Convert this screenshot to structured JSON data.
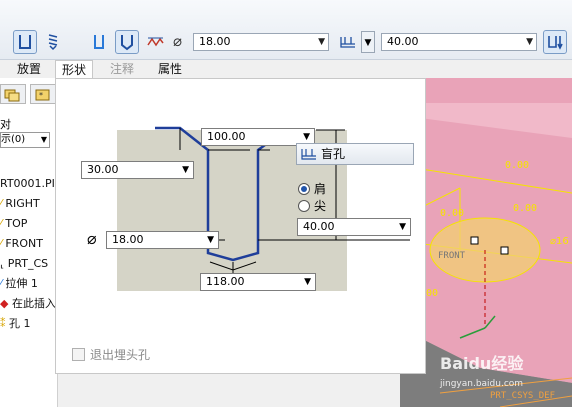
{
  "toolbar": {
    "diameter_symbol": "⌀",
    "diameter_value": "18.00",
    "depth_value": "40.00"
  },
  "tabs": [
    {
      "label": "放置"
    },
    {
      "label": "形状"
    },
    {
      "label": "注释"
    },
    {
      "label": "属性"
    }
  ],
  "tree": {
    "filter_label": "对",
    "show_label": "示(0)",
    "items": [
      {
        "label": "RT0001.PI"
      },
      {
        "label": "RIGHT"
      },
      {
        "label": "TOP"
      },
      {
        "label": "FRONT"
      },
      {
        "label": "PRT_CS"
      },
      {
        "label": "拉伸 1"
      },
      {
        "label": "在此插入"
      },
      {
        "label": "孔 1"
      }
    ]
  },
  "shape": {
    "top_dim": "100.00",
    "left_dim": "30.00",
    "diameter_symbol": "⌀",
    "diameter_dim": "18.00",
    "bottom_dim": "118.00",
    "depth_dim": "40.00",
    "depth_type": "盲孔",
    "radio_shoulder": "肩",
    "radio_tip": "尖",
    "checkbox_label": "退出埋头孔"
  },
  "graphics": {
    "dim_label_1": "0.00",
    "dim_label_2": "0.00",
    "dim_label_3": "0.00",
    "dim_label_4": "0.00",
    "front_label": "FRONT",
    "ring_label": "16",
    "csys_label": "PRT_CSYS_DEF",
    "watermark": "Baidu经验",
    "watermark_url": "jingyan.baidu.com"
  },
  "colors": {
    "accent": "#1f4fa0",
    "pink": "#e9a3b8",
    "yellow": "#f5e400"
  }
}
